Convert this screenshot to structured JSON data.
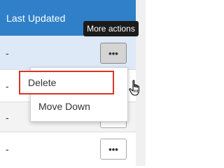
{
  "table": {
    "column_header": "Last Updated",
    "rows": [
      {
        "last_updated": "-",
        "actions_label": "•••"
      },
      {
        "last_updated": "-",
        "actions_label": "•••"
      },
      {
        "last_updated": "-",
        "actions_label": "•••"
      },
      {
        "last_updated": "-",
        "actions_label": "•••"
      }
    ]
  },
  "tooltip": {
    "text": "More actions"
  },
  "menu": {
    "items": [
      {
        "label": "Delete"
      },
      {
        "label": "Move Down"
      }
    ]
  },
  "colors": {
    "header_bg": "#2f80c9",
    "selected_row_bg": "#dde9f7",
    "highlight_border": "#d9342b"
  },
  "icons": {
    "actions": "more-horizontal-icon",
    "cursor": "hand-pointer-icon"
  }
}
